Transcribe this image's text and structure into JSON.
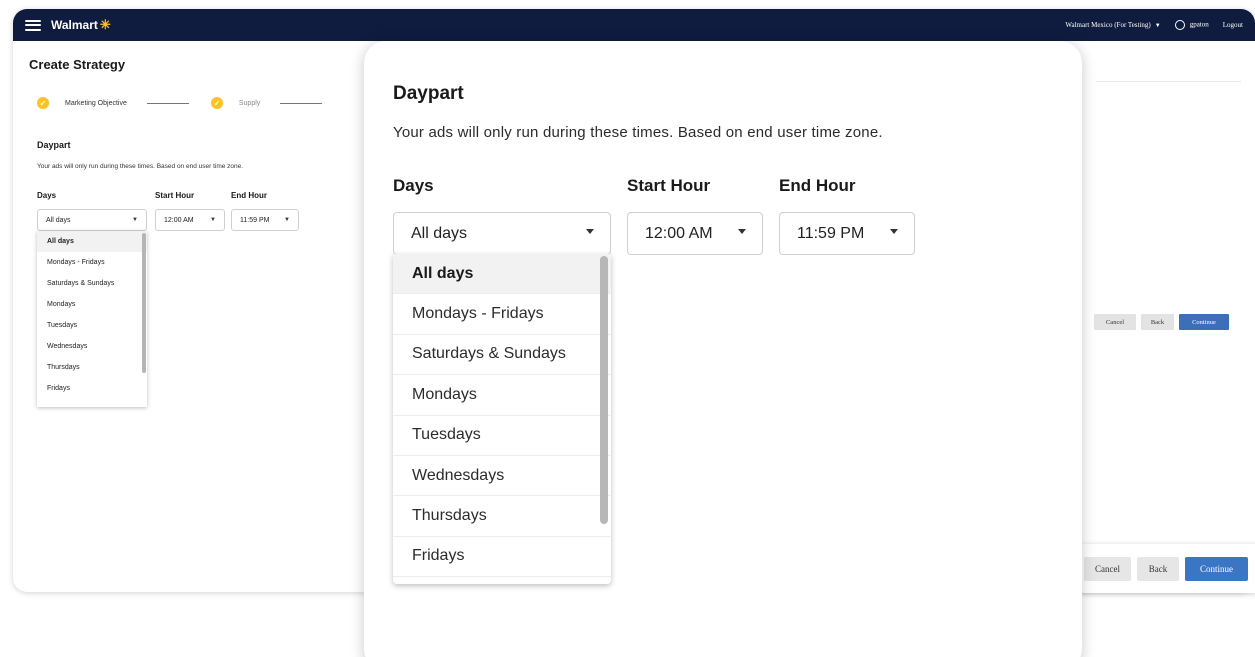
{
  "header": {
    "brand": "Walmart",
    "account": "Walmart Mexico (For Testing)",
    "username": "gpaton",
    "logout": "Logout"
  },
  "page": {
    "title": "Create Strategy",
    "steps": [
      {
        "label": "Marketing Objective",
        "status": "complete"
      },
      {
        "label": "Supply",
        "status": "complete"
      }
    ]
  },
  "daypart": {
    "title": "Daypart",
    "description": "Your ads will only run during these times. Based on end user time zone.",
    "days_label": "Days",
    "start_label": "Start Hour",
    "end_label": "End Hour",
    "days_value": "All days",
    "start_value": "12:00 AM",
    "end_value": "11:59 PM",
    "day_options": [
      "All days",
      "Mondays - Fridays",
      "Saturdays & Sundays",
      "Mondays",
      "Tuesdays",
      "Wednesdays",
      "Thursdays",
      "Fridays"
    ],
    "selected_index": 0
  },
  "actions": {
    "cancel": "Cancel",
    "back": "Back",
    "continue": "Continue"
  },
  "colors": {
    "nav_bg": "#0f1c3f",
    "step_complete": "#ffc220",
    "primary_button": "#3b76c4"
  },
  "icons": [
    "menu-icon",
    "walmart-spark-icon",
    "chevron-down-icon",
    "user-icon",
    "check-icon"
  ]
}
